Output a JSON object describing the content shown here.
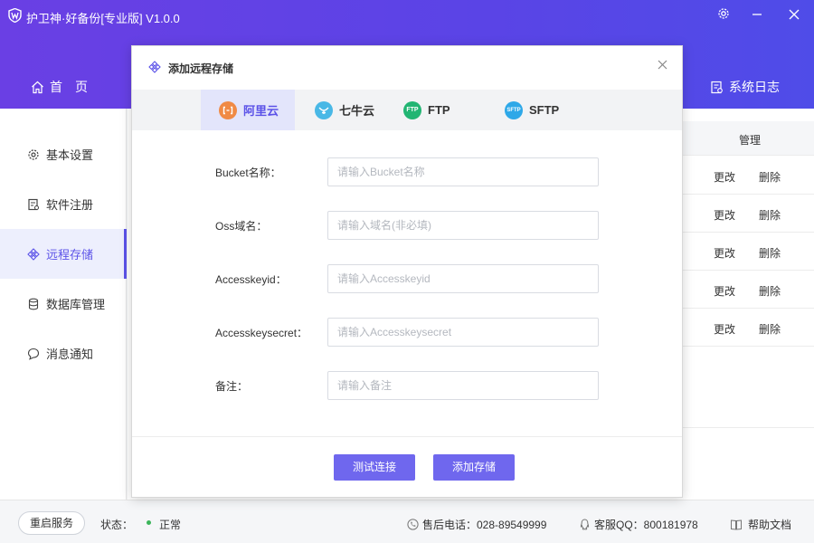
{
  "app": {
    "title": "护卫神·好备份[专业版]  V1.0.0"
  },
  "nav": {
    "home": "首　页",
    "log": "系统日志"
  },
  "sidebar": {
    "items": [
      {
        "label": "基本设置"
      },
      {
        "label": "软件注册"
      },
      {
        "label": "远程存储"
      },
      {
        "label": "数据库管理"
      },
      {
        "label": "消息通知"
      }
    ]
  },
  "table": {
    "header": "管理",
    "rows": [
      {
        "edit": "更改",
        "delete": "删除"
      },
      {
        "edit": "更改",
        "delete": "删除"
      },
      {
        "edit": "更改",
        "delete": "删除"
      },
      {
        "edit": "更改",
        "delete": "删除"
      },
      {
        "edit": "更改",
        "delete": "删除"
      }
    ]
  },
  "modal": {
    "title": "添加远程存储",
    "tabs": [
      {
        "label": "阿里云",
        "icon": "aliyun-icon"
      },
      {
        "label": "七牛云",
        "icon": "qiniu-icon"
      },
      {
        "label": "FTP",
        "icon": "ftp-icon"
      },
      {
        "label": "SFTP",
        "icon": "sftp-icon"
      }
    ],
    "fields": [
      {
        "label": "Bucket名称：",
        "placeholder": "请输入Bucket名称",
        "value": ""
      },
      {
        "label": "Oss域名：",
        "placeholder": "请输入域名(非必填)",
        "value": ""
      },
      {
        "label": "Accesskeyid：",
        "placeholder": "请输入Accesskeyid",
        "value": ""
      },
      {
        "label": "Accesskeysecret：",
        "placeholder": "请输入Accesskeysecret",
        "value": ""
      },
      {
        "label": "备注：",
        "placeholder": "请输入备注",
        "value": ""
      }
    ],
    "test_button": "测试连接",
    "add_button": "添加存储"
  },
  "status": {
    "restart_button": "重启服务",
    "label": "状态：",
    "value": "正常",
    "phone": "售后电话：028-89549999",
    "qq": "客服QQ：800181978",
    "help": "帮助文档"
  },
  "colors": {
    "accent": "#5b52e8",
    "button": "#6f67ee",
    "status_ok": "#3bb55a"
  }
}
